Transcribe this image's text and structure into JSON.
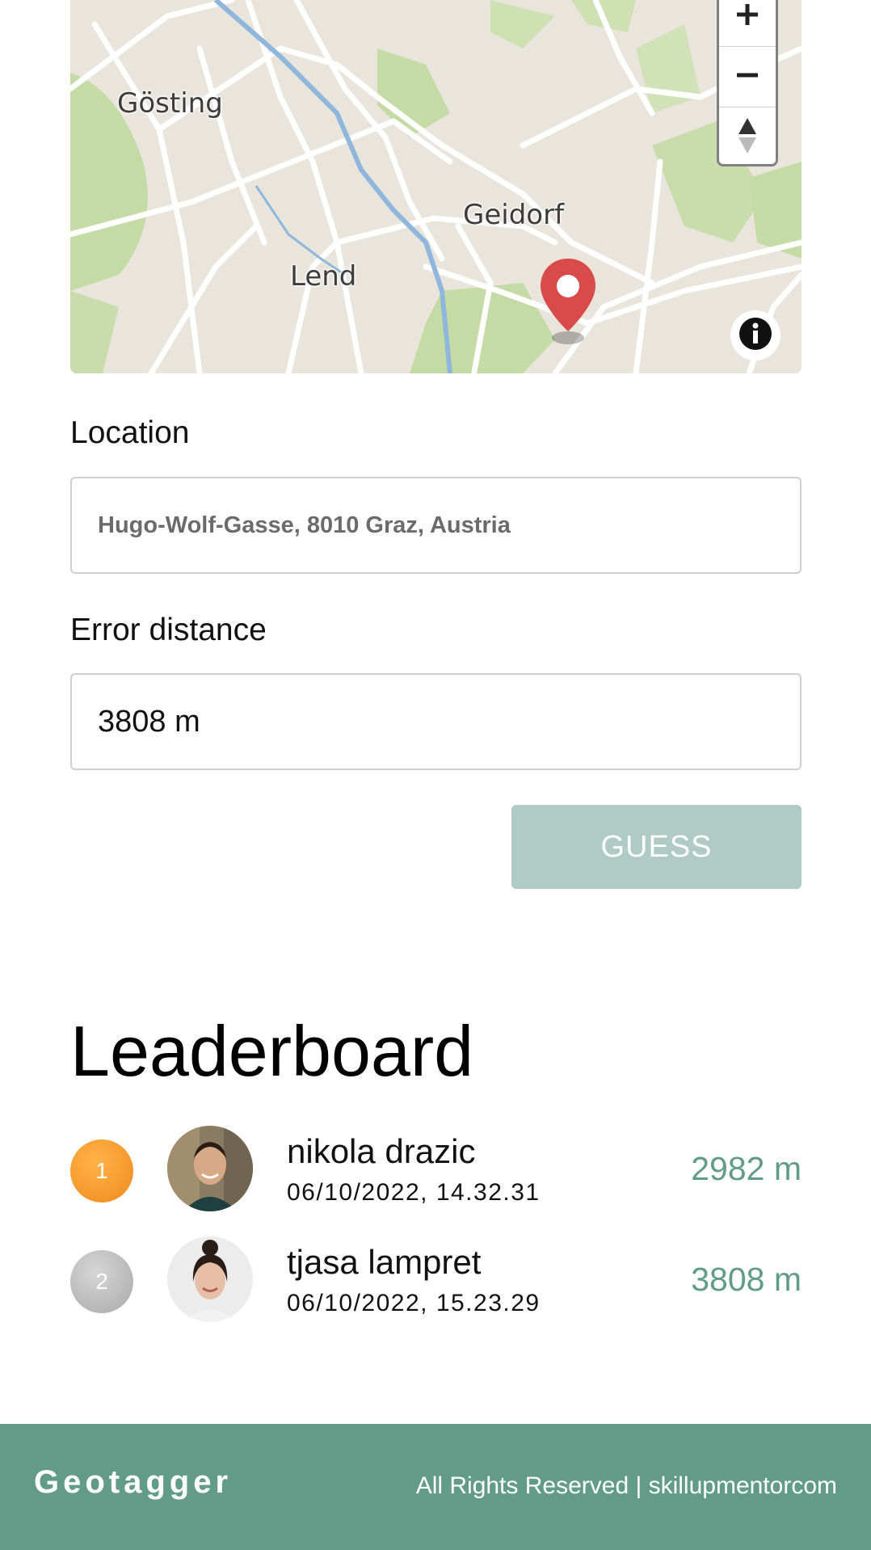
{
  "map": {
    "labels": [
      "Gösting",
      "Geidorf",
      "Lend"
    ],
    "zoom_in_icon": "plus-icon",
    "zoom_out_icon": "minus-icon",
    "reset_icon": "compass-icon",
    "info_icon": "info-icon",
    "marker_icon": "map-pin-icon"
  },
  "form": {
    "location_label": "Location",
    "location_value": "Hugo-Wolf-Gasse, 8010 Graz, Austria",
    "distance_label": "Error distance",
    "distance_value": "3808 m",
    "guess_label": "GUESS"
  },
  "leaderboard": {
    "title": "Leaderboard",
    "entries": [
      {
        "rank": "1",
        "name": "nikola drazic",
        "datetime": "06/10/2022, 14.32.31",
        "distance": "2982 m"
      },
      {
        "rank": "2",
        "name": "tjasa lampret",
        "datetime": "06/10/2022, 15.23.29",
        "distance": "3808 m"
      }
    ]
  },
  "footer": {
    "brand": "Geotagger",
    "copyright": "All Rights Reserved | skillupmentorcom"
  },
  "colors": {
    "accent": "#629c89",
    "distance_text": "#619c88",
    "guess_button_disabled": "#afcbc4",
    "gold": "#f39a2c",
    "silver": "#b5b5b5",
    "marker": "#d94a4a"
  }
}
